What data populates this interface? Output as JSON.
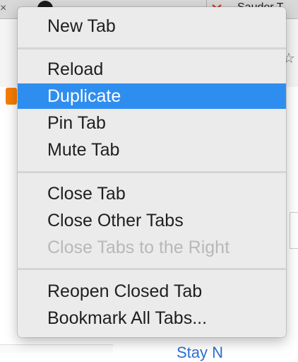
{
  "background": {
    "tab_close_glyph": "×",
    "tab_title": "Sauder T",
    "bookmark_star_glyph": "☆",
    "bottom_link_text": "Stay N"
  },
  "menu": {
    "items": [
      {
        "label": "New Tab",
        "state": "normal"
      },
      {
        "label": "Reload",
        "state": "normal"
      },
      {
        "label": "Duplicate",
        "state": "highlighted"
      },
      {
        "label": "Pin Tab",
        "state": "normal"
      },
      {
        "label": "Mute Tab",
        "state": "normal"
      },
      {
        "label": "Close Tab",
        "state": "normal"
      },
      {
        "label": "Close Other Tabs",
        "state": "normal"
      },
      {
        "label": "Close Tabs to the Right",
        "state": "disabled"
      },
      {
        "label": "Reopen Closed Tab",
        "state": "normal"
      },
      {
        "label": "Bookmark All Tabs...",
        "state": "normal"
      }
    ]
  },
  "colors": {
    "menu_background": "#ebebeb",
    "highlight": "#2e8ef0",
    "text": "#1f1f1f",
    "disabled_text": "#b8b8b8",
    "separator": "#d5d5d5"
  },
  "icons": {
    "tab_close": "close-icon",
    "github_avatar": "avatar",
    "gmail": "gmail-icon",
    "bookmark": "star-icon",
    "blogger": "blogger-icon"
  }
}
